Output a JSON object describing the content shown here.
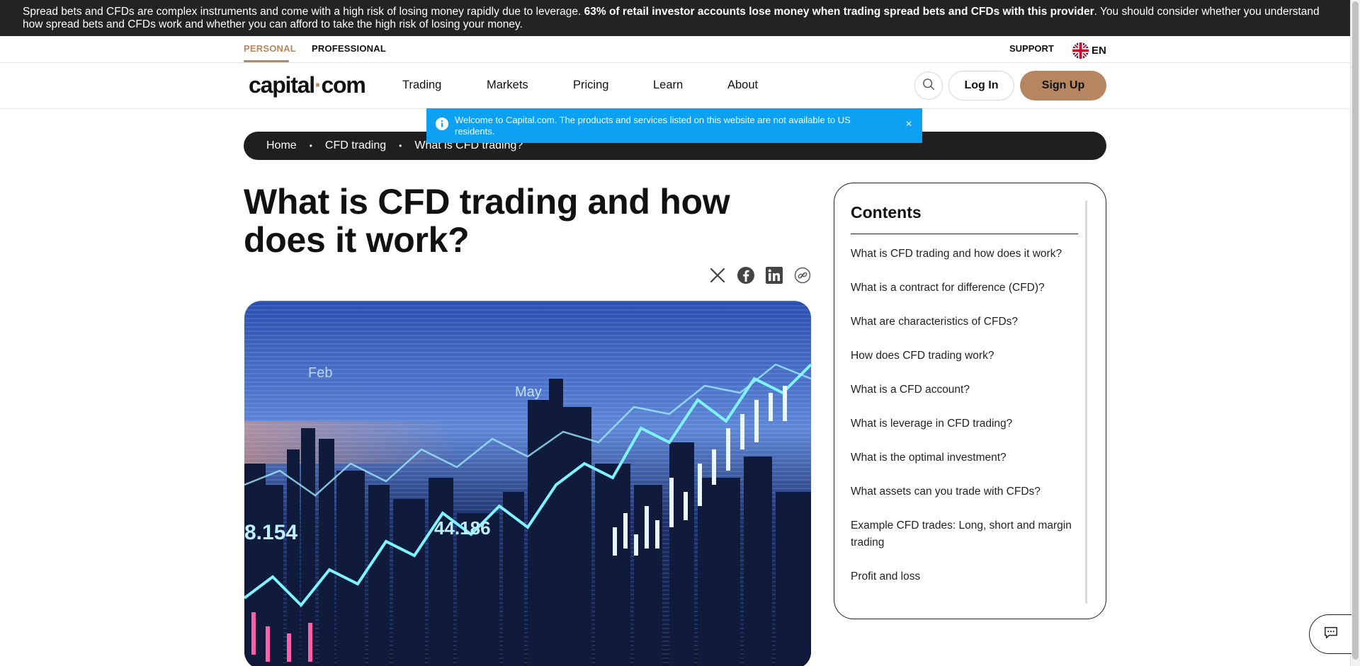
{
  "risk_banner": {
    "text_before": "Spread bets and CFDs are complex instruments and come with a high risk of losing money rapidly due to leverage. ",
    "text_bold": "63% of retail investor accounts lose money when trading spread bets and CFDs with this provider",
    "text_after": ". You should consider whether you understand how spread bets and CFDs work and whether you can afford to take the high risk of losing your money."
  },
  "audience": {
    "personal": "PERSONAL",
    "professional": "PROFESSIONAL",
    "support": "SUPPORT",
    "language": "EN",
    "flag_icon": "uk-flag-icon"
  },
  "header": {
    "logo_left": "capital",
    "logo_dot": "·",
    "logo_right": "com",
    "nav": [
      "Trading",
      "Markets",
      "Pricing",
      "Learn",
      "About"
    ],
    "search_icon": "search-icon",
    "login": "Log In",
    "signup": "Sign Up",
    "accent": "#b5865f"
  },
  "notice": {
    "text": "Welcome to Capital.com. The products and services listed on this website are not available to US residents.",
    "close": "×",
    "color": "#0ea0f2"
  },
  "breadcrumb": {
    "items": [
      "Home",
      "CFD trading",
      "What is CFD trading?"
    ],
    "separator": "•"
  },
  "article": {
    "title": "What is CFD trading and how does it work?",
    "share_icons": [
      "x-icon",
      "facebook-icon",
      "linkedin-icon",
      "copy-link-icon"
    ],
    "hero": {
      "labels": [
        "Feb",
        "May",
        "8.154",
        "44.186"
      ]
    }
  },
  "contents": {
    "title": "Contents",
    "items": [
      "What is CFD trading and how does it work?",
      "What is a contract for difference (CFD)?",
      "What are characteristics of CFDs?",
      "How does CFD trading work?",
      "What is a CFD account?",
      "What is leverage in CFD trading?",
      "What is the optimal investment?",
      "What assets can you trade with CFDs?",
      "Example CFD trades: Long, short and margin trading",
      "Profit and loss"
    ]
  },
  "chat": {
    "icon": "chat-icon"
  }
}
